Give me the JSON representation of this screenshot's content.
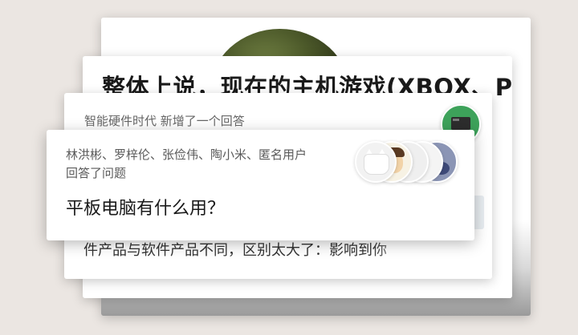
{
  "background_card": {
    "image": "planet-image"
  },
  "article_card": {
    "title": "整体上说，现在的主机游戏(XBOX、PS"
  },
  "answer_card": {
    "meta": "智能硬件时代 新增了一个回答",
    "avatar": "device-avatar",
    "excerpt": "件产品与软件产品不同，区别太大了：影响到你"
  },
  "question_card": {
    "users": "林洪彬、罗梓伦、张俭伟、陶小米、匿名用户",
    "action": "回答了问题",
    "title": "平板电脑有什么用？",
    "avatars": [
      "cat-avatar",
      "person-avatar",
      "plain-avatar",
      "plant-avatar",
      "photo-avatar"
    ]
  },
  "colors": {
    "background": "#ebe6e2",
    "accent_green": "#3da25a"
  }
}
